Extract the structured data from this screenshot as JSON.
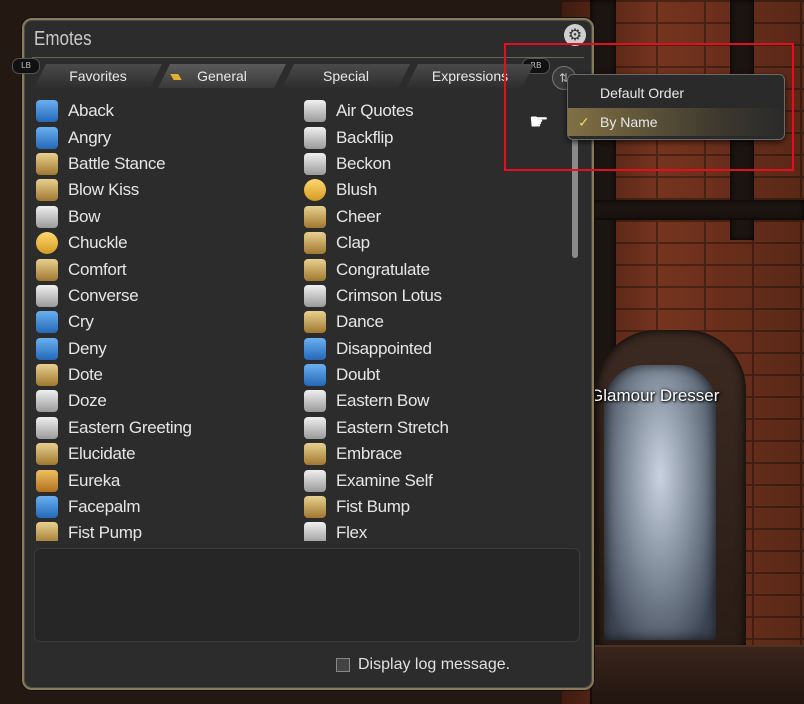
{
  "window": {
    "title": "Emotes",
    "settings_icon": "gear-icon",
    "pad_left": "LB",
    "pad_right": "RB",
    "sort_icon": "sort-arrows-icon"
  },
  "tabs": [
    {
      "label": "Favorites",
      "active": false
    },
    {
      "label": "General",
      "active": true
    },
    {
      "label": "Special",
      "active": false
    },
    {
      "label": "Expressions",
      "active": false
    }
  ],
  "emotes_col1": [
    {
      "label": "Aback",
      "icon": "blue"
    },
    {
      "label": "Angry",
      "icon": "blue"
    },
    {
      "label": "Battle Stance",
      "icon": "tan"
    },
    {
      "label": "Blow Kiss",
      "icon": "tan"
    },
    {
      "label": "Bow",
      "icon": "gray"
    },
    {
      "label": "Chuckle",
      "icon": "yellow"
    },
    {
      "label": "Comfort",
      "icon": "tan"
    },
    {
      "label": "Converse",
      "icon": "gray"
    },
    {
      "label": "Cry",
      "icon": "blue"
    },
    {
      "label": "Deny",
      "icon": "blue"
    },
    {
      "label": "Dote",
      "icon": "tan"
    },
    {
      "label": "Doze",
      "icon": "gray"
    },
    {
      "label": "Eastern Greeting",
      "icon": "gray"
    },
    {
      "label": "Elucidate",
      "icon": "tan"
    },
    {
      "label": "Eureka",
      "icon": "gold"
    },
    {
      "label": "Facepalm",
      "icon": "blue"
    },
    {
      "label": "Fist Pump",
      "icon": "tan"
    }
  ],
  "emotes_col2": [
    {
      "label": "Air Quotes",
      "icon": "gray"
    },
    {
      "label": "Backflip",
      "icon": "gray"
    },
    {
      "label": "Beckon",
      "icon": "gray"
    },
    {
      "label": "Blush",
      "icon": "yellow"
    },
    {
      "label": "Cheer",
      "icon": "tan"
    },
    {
      "label": "Clap",
      "icon": "tan"
    },
    {
      "label": "Congratulate",
      "icon": "tan"
    },
    {
      "label": "Crimson Lotus",
      "icon": "gray"
    },
    {
      "label": "Dance",
      "icon": "tan"
    },
    {
      "label": "Disappointed",
      "icon": "blue"
    },
    {
      "label": "Doubt",
      "icon": "blue"
    },
    {
      "label": "Eastern Bow",
      "icon": "gray"
    },
    {
      "label": "Eastern Stretch",
      "icon": "gray"
    },
    {
      "label": "Embrace",
      "icon": "tan"
    },
    {
      "label": "Examine Self",
      "icon": "gray"
    },
    {
      "label": "Fist Bump",
      "icon": "tan"
    },
    {
      "label": "Flex",
      "icon": "gray"
    }
  ],
  "log": {
    "checkbox_label": "Display log message.",
    "checked": false
  },
  "sort_menu": {
    "items": [
      {
        "label": "Default Order",
        "selected": false
      },
      {
        "label": "By Name",
        "selected": true
      }
    ],
    "check_glyph": "✓",
    "pointer_icon": "hand-pointer-icon"
  },
  "world": {
    "label": "Glamour Dresser"
  },
  "colors": {
    "highlight": "#e01020",
    "window_border": "#8a7a5a",
    "selected_check": "#f0d060"
  }
}
